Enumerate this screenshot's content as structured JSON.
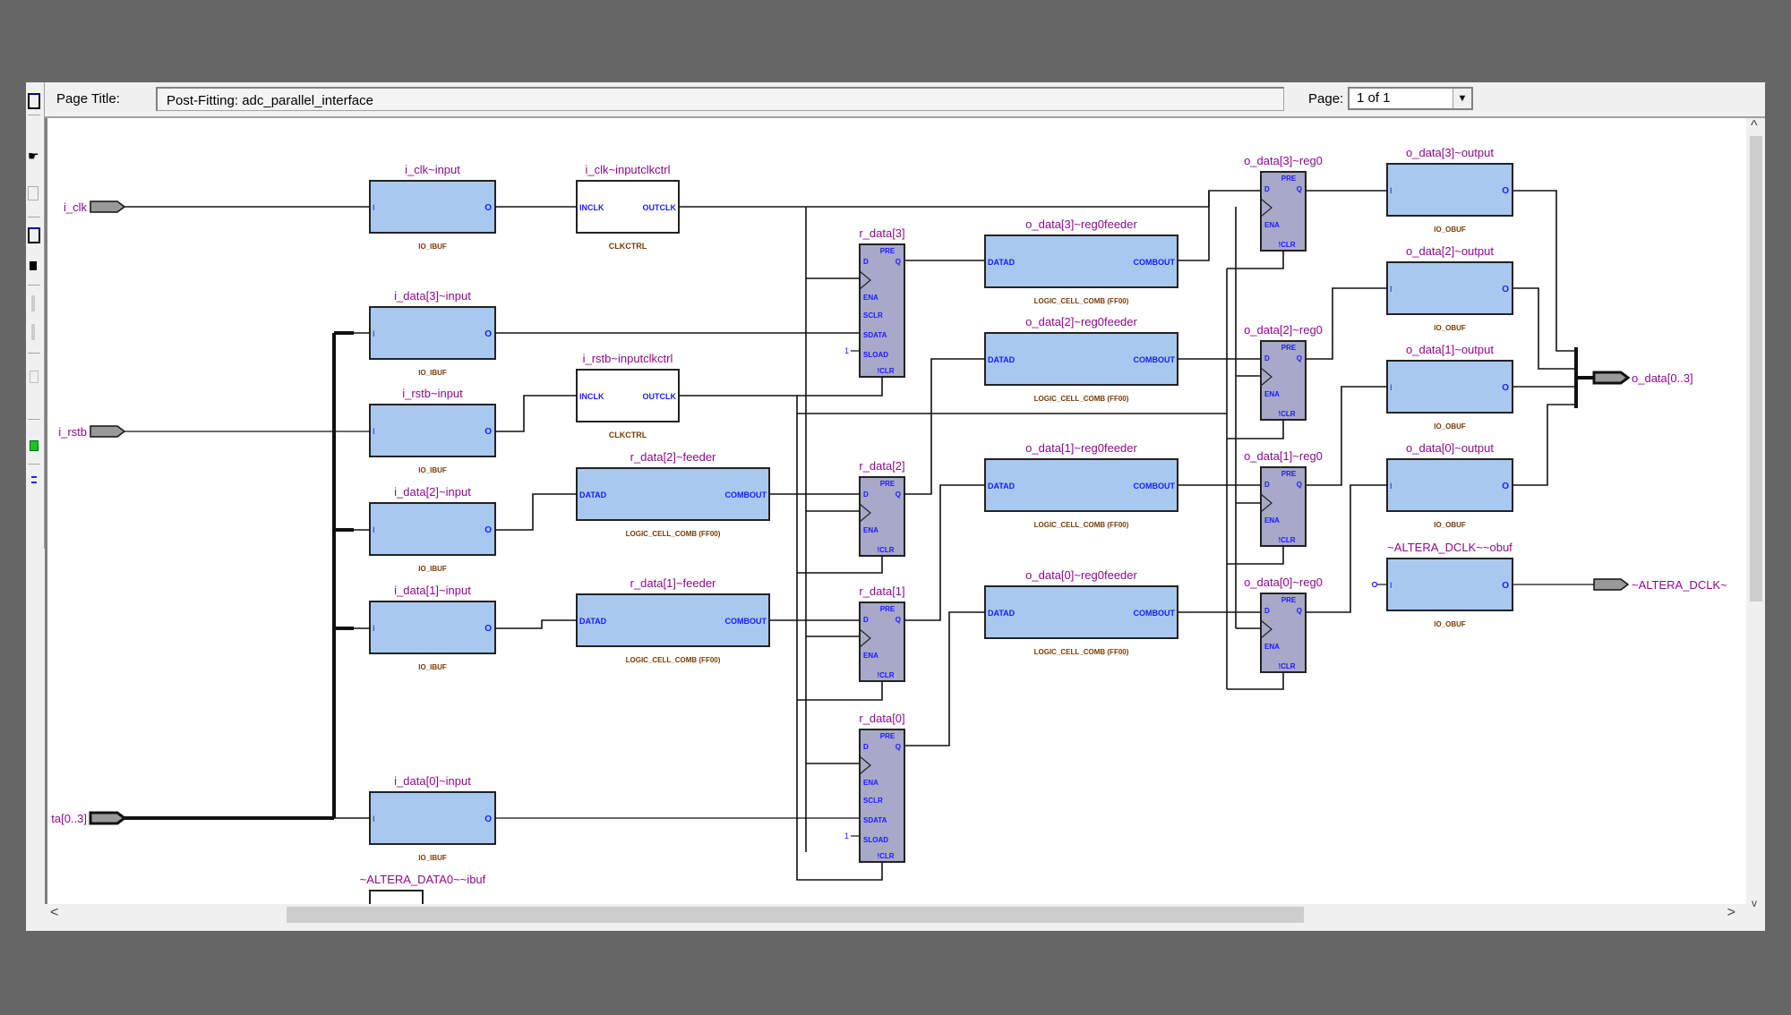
{
  "header": {
    "page_title_label": "Page Title:",
    "page_title_value": "Post-Fitting: adc_parallel_interface",
    "page_label": "Page:",
    "page_value": "1 of 1"
  },
  "colors": {
    "instance_name": "#8b0a8b",
    "port_label": "#1a1aff",
    "buffer_fill": "#a8c8f0",
    "register_fill": "#a8a8c8",
    "type_label": "#7a3a00",
    "pin_fill": "#999999"
  },
  "input_pins": [
    {
      "label": "i_clk"
    },
    {
      "label": "i_rstb"
    },
    {
      "label": "ta[0..3]"
    }
  ],
  "output_pins": [
    {
      "label": "o_data[0..3]"
    },
    {
      "label": "~ALTERA_DCLK~"
    }
  ],
  "input_buffers": [
    {
      "name": "i_clk~input",
      "type": "IO_IBUF",
      "in": "I",
      "out": "O"
    },
    {
      "name": "i_data[3]~input",
      "type": "IO_IBUF",
      "in": "I",
      "out": "O"
    },
    {
      "name": "i_rstb~input",
      "type": "IO_IBUF",
      "in": "I",
      "out": "O"
    },
    {
      "name": "i_data[2]~input",
      "type": "IO_IBUF",
      "in": "I",
      "out": "O"
    },
    {
      "name": "i_data[1]~input",
      "type": "IO_IBUF",
      "in": "I",
      "out": "O"
    },
    {
      "name": "i_data[0]~input",
      "type": "IO_IBUF",
      "in": "I",
      "out": "O"
    }
  ],
  "clock_controls": [
    {
      "name": "i_clk~inputclkctrl",
      "type": "CLKCTRL",
      "in": "INCLK",
      "out": "OUTCLK"
    },
    {
      "name": "i_rstb~inputclkctrl",
      "type": "CLKCTRL",
      "in": "INCLK",
      "out": "OUTCLK"
    }
  ],
  "feeders": [
    {
      "name": "r_data[2]~feeder",
      "type": "LOGIC_CELL_COMB (FF00)",
      "in": "DATAD",
      "out": "COMBOUT"
    },
    {
      "name": "r_data[1]~feeder",
      "type": "LOGIC_CELL_COMB (FF00)",
      "in": "DATAD",
      "out": "COMBOUT"
    },
    {
      "name": "o_data[3]~reg0feeder",
      "type": "LOGIC_CELL_COMB (FF00)",
      "in": "DATAD",
      "out": "COMBOUT"
    },
    {
      "name": "o_data[2]~reg0feeder",
      "type": "LOGIC_CELL_COMB (FF00)",
      "in": "DATAD",
      "out": "COMBOUT"
    },
    {
      "name": "o_data[1]~reg0feeder",
      "type": "LOGIC_CELL_COMB (FF00)",
      "in": "DATAD",
      "out": "COMBOUT"
    },
    {
      "name": "o_data[0]~reg0feeder",
      "type": "LOGIC_CELL_COMB (FF00)",
      "in": "DATAD",
      "out": "COMBOUT"
    }
  ],
  "registers": [
    {
      "name": "r_data[3]",
      "ports": [
        "PRE",
        "D",
        "Q",
        "ENA",
        "SCLR",
        "SDATA",
        "SLOAD",
        "!CLR"
      ],
      "const": "1"
    },
    {
      "name": "r_data[2]",
      "ports": [
        "PRE",
        "D",
        "Q",
        "ENA",
        "!CLR"
      ]
    },
    {
      "name": "r_data[1]",
      "ports": [
        "PRE",
        "D",
        "Q",
        "ENA",
        "!CLR"
      ]
    },
    {
      "name": "r_data[0]",
      "ports": [
        "PRE",
        "D",
        "Q",
        "ENA",
        "SCLR",
        "SDATA",
        "SLOAD",
        "!CLR"
      ],
      "const": "1"
    },
    {
      "name": "o_data[3]~reg0",
      "ports": [
        "PRE",
        "D",
        "Q",
        "ENA",
        "!CLR"
      ]
    },
    {
      "name": "o_data[2]~reg0",
      "ports": [
        "PRE",
        "D",
        "Q",
        "ENA",
        "!CLR"
      ]
    },
    {
      "name": "o_data[1]~reg0",
      "ports": [
        "PRE",
        "D",
        "Q",
        "ENA",
        "!CLR"
      ]
    },
    {
      "name": "o_data[0]~reg0",
      "ports": [
        "PRE",
        "D",
        "Q",
        "ENA",
        "!CLR"
      ]
    }
  ],
  "output_buffers": [
    {
      "name": "o_data[3]~output",
      "type": "IO_OBUF",
      "in": "I",
      "out": "O"
    },
    {
      "name": "o_data[2]~output",
      "type": "IO_OBUF",
      "in": "I",
      "out": "O"
    },
    {
      "name": "o_data[1]~output",
      "type": "IO_OBUF",
      "in": "I",
      "out": "O"
    },
    {
      "name": "o_data[0]~output",
      "type": "IO_OBUF",
      "in": "I",
      "out": "O"
    },
    {
      "name": "~ALTERA_DCLK~~obuf",
      "type": "IO_OBUF",
      "in": "I",
      "out": "O"
    }
  ],
  "partial_cells": [
    {
      "name": "~ALTERA_DATA0~~ibuf"
    }
  ],
  "scrollbars": {
    "vertical": {
      "up": "^",
      "down": "v"
    },
    "horizontal": {
      "left": "<",
      "right": ">"
    }
  }
}
